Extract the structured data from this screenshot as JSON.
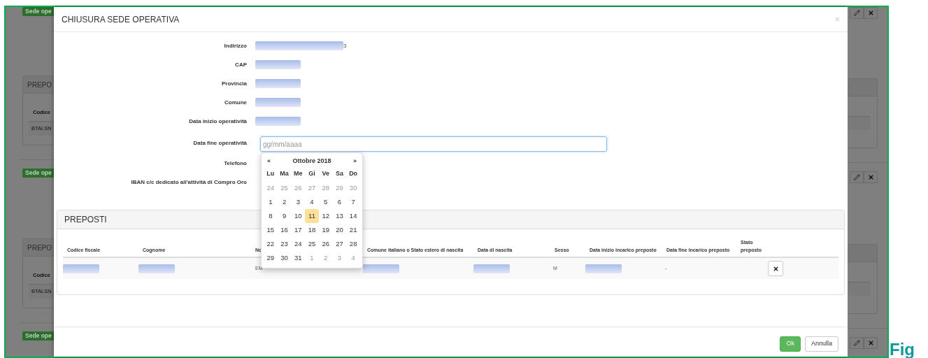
{
  "background_page": {
    "badges": [
      "Sede ope",
      "Sede ope",
      "Sede ope"
    ],
    "panels": [
      {
        "title": "PREPO",
        "column": "Codice",
        "cell": "BTALSN"
      },
      {
        "title": "PREPO",
        "column": "Codice",
        "cell": "BTALSN"
      }
    ]
  },
  "modal": {
    "title": "CHIUSURA SEDE OPERATIVA",
    "close": "×",
    "fields": [
      {
        "label": "Indirizzo",
        "kind": "redacted_long",
        "suffix": "3"
      },
      {
        "label": "CAP",
        "kind": "redacted"
      },
      {
        "label": "Provincia",
        "kind": "redacted"
      },
      {
        "label": "Comune",
        "kind": "redacted"
      },
      {
        "label": "Data inizio operatività",
        "kind": "redacted"
      },
      {
        "label": "Data fine operatività",
        "kind": "date_input",
        "placeholder": "gg/mm/aaaa",
        "focused": true
      },
      {
        "label": "Telefono",
        "kind": "empty"
      },
      {
        "label": "IBAN c/c dedicato all'attività di Compro Oro",
        "kind": "empty"
      }
    ],
    "calendar": {
      "prev": "«",
      "month_label": "Ottobre 2018",
      "next": "»",
      "weekdays": [
        "Lu",
        "Ma",
        "Me",
        "Gi",
        "Ve",
        "Sa",
        "Do"
      ],
      "weeks": [
        [
          {
            "d": "24",
            "outside": true,
            "selected": false
          },
          {
            "d": "25",
            "outside": true,
            "selected": false
          },
          {
            "d": "26",
            "outside": true,
            "selected": false
          },
          {
            "d": "27",
            "outside": true,
            "selected": false
          },
          {
            "d": "28",
            "outside": true,
            "selected": false
          },
          {
            "d": "29",
            "outside": true,
            "selected": false
          },
          {
            "d": "30",
            "outside": true,
            "selected": false
          }
        ],
        [
          {
            "d": "1",
            "outside": false,
            "selected": false
          },
          {
            "d": "2",
            "outside": false,
            "selected": false
          },
          {
            "d": "3",
            "outside": false,
            "selected": false
          },
          {
            "d": "4",
            "outside": false,
            "selected": false
          },
          {
            "d": "5",
            "outside": false,
            "selected": false
          },
          {
            "d": "6",
            "outside": false,
            "selected": false
          },
          {
            "d": "7",
            "outside": false,
            "selected": false
          }
        ],
        [
          {
            "d": "8",
            "outside": false,
            "selected": false
          },
          {
            "d": "9",
            "outside": false,
            "selected": false
          },
          {
            "d": "10",
            "outside": false,
            "selected": false
          },
          {
            "d": "11",
            "outside": false,
            "selected": true
          },
          {
            "d": "12",
            "outside": false,
            "selected": false
          },
          {
            "d": "13",
            "outside": false,
            "selected": false
          },
          {
            "d": "14",
            "outside": false,
            "selected": false
          }
        ],
        [
          {
            "d": "15",
            "outside": false,
            "selected": false
          },
          {
            "d": "16",
            "outside": false,
            "selected": false
          },
          {
            "d": "17",
            "outside": false,
            "selected": false
          },
          {
            "d": "18",
            "outside": false,
            "selected": false
          },
          {
            "d": "19",
            "outside": false,
            "selected": false
          },
          {
            "d": "20",
            "outside": false,
            "selected": false
          },
          {
            "d": "21",
            "outside": false,
            "selected": false
          }
        ],
        [
          {
            "d": "22",
            "outside": false,
            "selected": false
          },
          {
            "d": "23",
            "outside": false,
            "selected": false
          },
          {
            "d": "24",
            "outside": false,
            "selected": false
          },
          {
            "d": "25",
            "outside": false,
            "selected": false
          },
          {
            "d": "26",
            "outside": false,
            "selected": false
          },
          {
            "d": "27",
            "outside": false,
            "selected": false
          },
          {
            "d": "28",
            "outside": false,
            "selected": false
          }
        ],
        [
          {
            "d": "29",
            "outside": false,
            "selected": false
          },
          {
            "d": "30",
            "outside": false,
            "selected": false
          },
          {
            "d": "31",
            "outside": false,
            "selected": false
          },
          {
            "d": "1",
            "outside": true,
            "selected": false
          },
          {
            "d": "2",
            "outside": true,
            "selected": false
          },
          {
            "d": "3",
            "outside": true,
            "selected": false
          },
          {
            "d": "4",
            "outside": true,
            "selected": false
          }
        ]
      ]
    },
    "preposti": {
      "title": "PREPOSTI",
      "columns": [
        "Codice fiscale",
        "Cognome",
        "No",
        "Comune italiano o Stato estero di nascita",
        "Data di nascita",
        "Sesso",
        "Data inizio incarico preposto",
        "Data fine incarico preposto",
        "Stato preposto"
      ],
      "rows": [
        {
          "cells": [
            {
              "kind": "redacted"
            },
            {
              "kind": "redacted"
            },
            {
              "kind": "text",
              "text": "EM"
            },
            {
              "kind": "redacted"
            },
            {
              "kind": "redacted"
            },
            {
              "kind": "text",
              "text": "M"
            },
            {
              "kind": "redacted"
            },
            {
              "kind": "text",
              "text": "-"
            },
            {
              "kind": "empty"
            }
          ],
          "remove": true
        }
      ]
    },
    "buttons": [
      {
        "label": "Ok",
        "kind": "primary"
      },
      {
        "label": "Annulla",
        "kind": "default"
      }
    ]
  },
  "caption": "Fig"
}
